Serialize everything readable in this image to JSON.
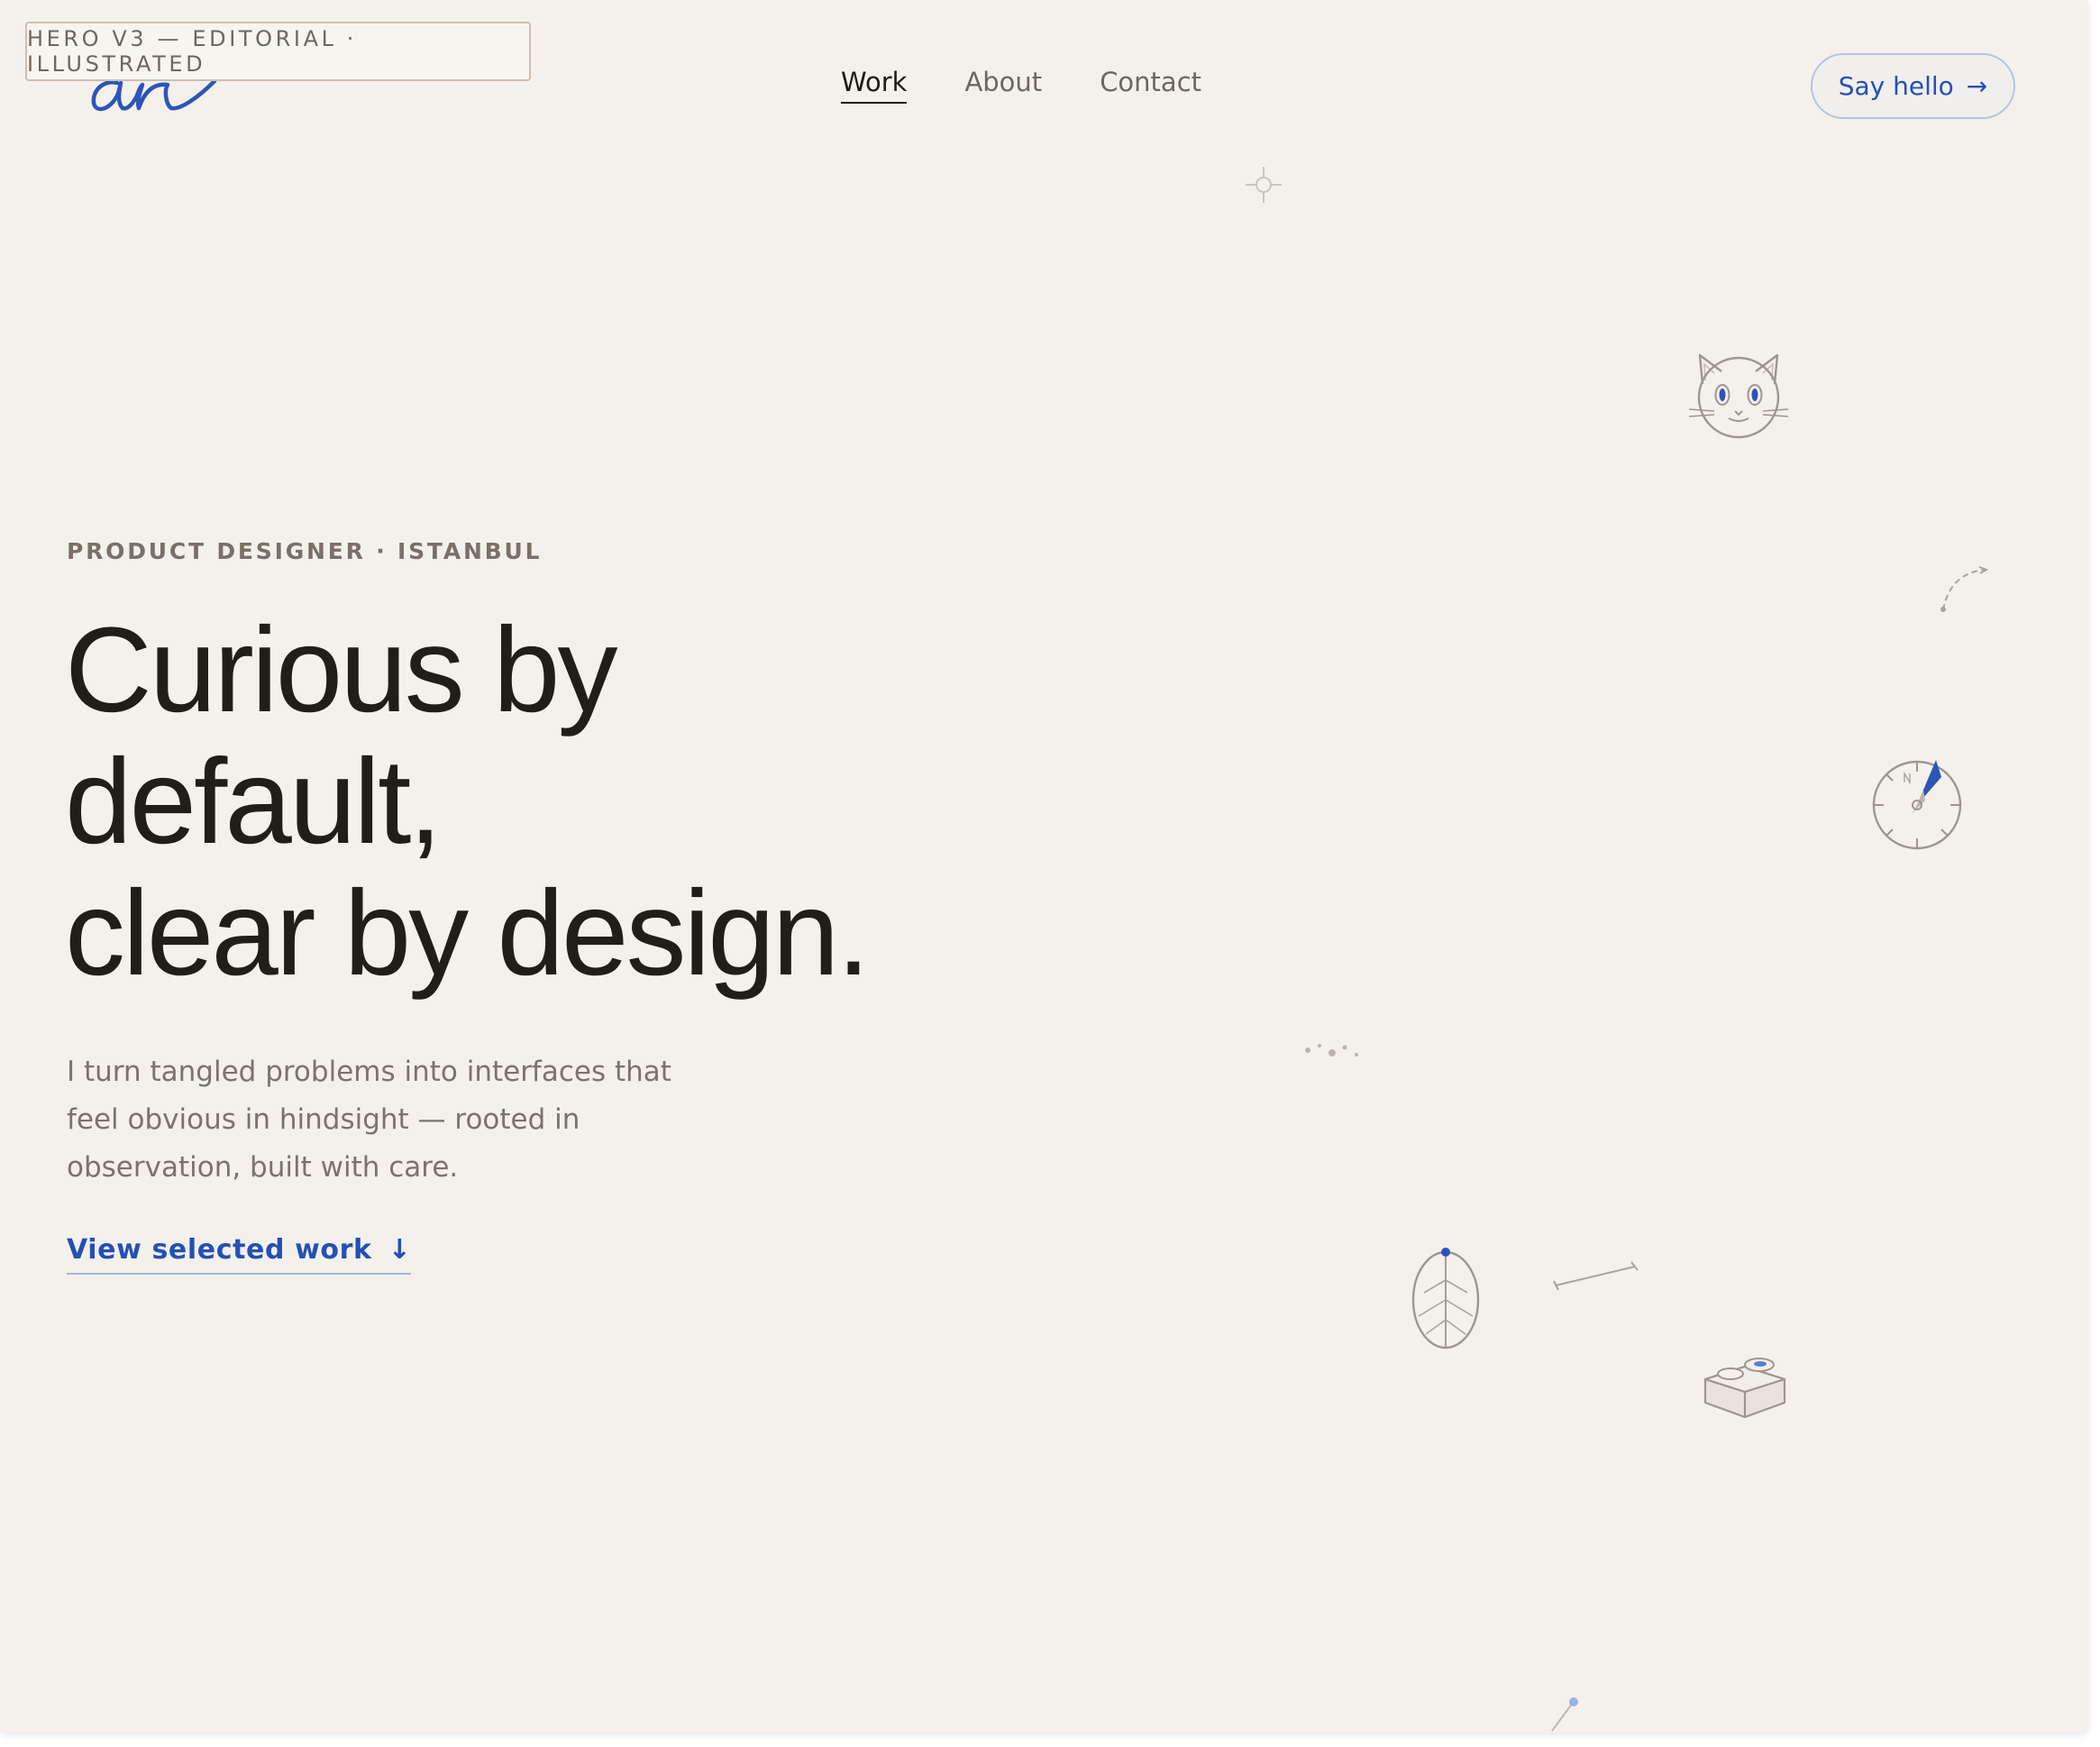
{
  "page": {
    "version_tag": "HERO V3 — EDITORIAL · ILLUSTRATED"
  },
  "colors": {
    "background": "#f4f1ec",
    "text_primary": "#211e1a",
    "text_muted": "#7c736b",
    "accent": "#2350b4"
  },
  "header": {
    "logo_icon": "signature-logo",
    "nav": [
      {
        "label": "Work",
        "active": true
      },
      {
        "label": "About",
        "active": false
      },
      {
        "label": "Contact",
        "active": false
      }
    ],
    "cta_label": "Say hello",
    "cta_icon": "→"
  },
  "hero": {
    "eyebrow": "PRODUCT DESIGNER · ISTANBUL",
    "headline_lines": [
      "Curious by",
      "default,",
      "clear by design."
    ],
    "subtext_lines": [
      "I turn tangled problems into interfaces that",
      "feel obvious in hindsight — rooted in",
      "observation, built with care."
    ],
    "link_label": "View selected work",
    "link_icon": "↓"
  },
  "illustrations": [
    "crosshair-icon",
    "cat-icon",
    "dashed-arrow-icon",
    "compass-icon",
    "dots-icon",
    "leaf-icon",
    "line-icon",
    "box-icon",
    "pin-icon"
  ]
}
